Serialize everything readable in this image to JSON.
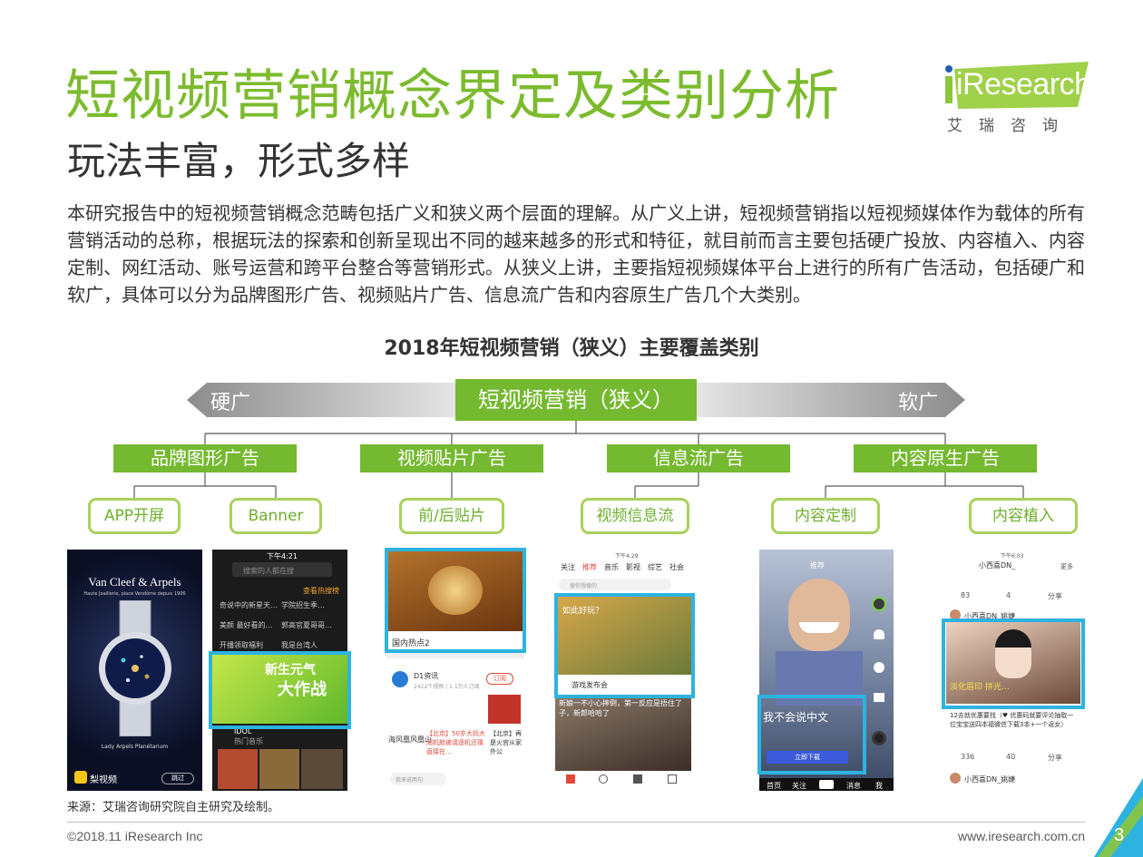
{
  "header": {
    "title": "短视频营销概念界定及类别分析",
    "subtitle": "玩法丰富，形式多样"
  },
  "logo": {
    "brand": "iResearch",
    "tagline": "艾瑞咨询"
  },
  "body_text": "本研究报告中的短视频营销概念范畴包括广义和狭义两个层面的理解。从广义上讲，短视频营销指以短视频媒体作为载体的所有营销活动的总称，根据玩法的探索和创新呈现出不同的越来越多的形式和特征，就目前而言主要包括硬广投放、内容植入、内容定制、网红活动、账号运营和跨平台整合等营销形式。从狭义上讲，主要指短视频媒体平台上进行的所有广告活动，包括硬广和软广，具体可以分为品牌图形广告、视频贴片广告、信息流广告和内容原生广告几个大类别。",
  "diagram": {
    "title": "2018年短视频营销（狭义）主要覆盖类别",
    "center": "短视频营销（狭义）",
    "left_end": "硬广",
    "right_end": "软广",
    "categories": [
      "品牌图形广告",
      "视频贴片广告",
      "信息流广告",
      "内容原生广告"
    ],
    "sub_items": [
      "APP开屏",
      "Banner",
      "前/后贴片",
      "视频信息流",
      "内容定制",
      "内容植入"
    ]
  },
  "screenshots": {
    "s1": {
      "brand": "Van Cleef & Arpels",
      "brand_sub": "Haute Joaillerie, place Vendôme depuis 1906",
      "product": "Lady Arpels Planétarium",
      "app": "梨视频",
      "skip": "跳过"
    },
    "s2": {
      "status": "下午4:21",
      "search": "搜索的人都在搜",
      "hot": "查看热搜榜",
      "tags": [
        "奇说中的新星天…",
        "学院招生季…",
        "美颜 最好看的…",
        "郭高官夏哥哥…",
        "开播领取福利",
        "我是台湾人"
      ],
      "banner_l1": "新生元气",
      "banner_l2": "大作战",
      "idol": "IDOL",
      "idol_sub": "热门音乐"
    },
    "s3": {
      "headline": "国内热点2",
      "site": "D1资讯",
      "sub": "2422个视频 | 1.1万人订阅",
      "follow": "订阅",
      "news1": "海风凰风凰山",
      "news2": "【北京】50岁大妈大闹机舱被请逐机还猜直接在…",
      "news3": "【北京】再是火宫从家外公",
      "comment": "我来说两句"
    },
    "s4": {
      "status": "下午4:29",
      "tabs": [
        "关注",
        "推荐",
        "音乐",
        "影视",
        "综艺",
        "社会"
      ],
      "search": "搜你想搜的",
      "overlay": "如此好玩？",
      "account": "游戏发布会",
      "caption": "新娘一不小心摔倒，第一反应是捂住了子，新郎哈哈了"
    },
    "s5": {
      "tab": "推荐",
      "overlay": "我不会说中文",
      "download": "立即下载",
      "nav": [
        "首页",
        "关注",
        "消息",
        "我"
      ]
    },
    "s6": {
      "status": "下午6:03",
      "name": "小西喜DN_",
      "more": "更多",
      "stats": [
        "83",
        "4",
        "分享"
      ],
      "user": "小西喜DN_姚婕",
      "overlay": "淡化眉印 拼光…",
      "caption": "12去就优惠要找（♥ 优惠码就要评论抽取一位宝宝送四本福微信下载3本+一个返女）",
      "stats2": [
        "336",
        "40",
        "分享"
      ]
    }
  },
  "footer": {
    "source": "来源：艾瑞咨询研究院自主研究及绘制。",
    "copyright": "©2018.11 iResearch Inc",
    "website": "www.iresearch.com.cn",
    "page": "3"
  },
  "colors": {
    "brand_green": "#74b92f",
    "title_green": "#7cbb2e",
    "highlight_blue": "#2eb3e0",
    "sub_border": "#a8d15c",
    "footer_corner": "#2eb3e0"
  }
}
